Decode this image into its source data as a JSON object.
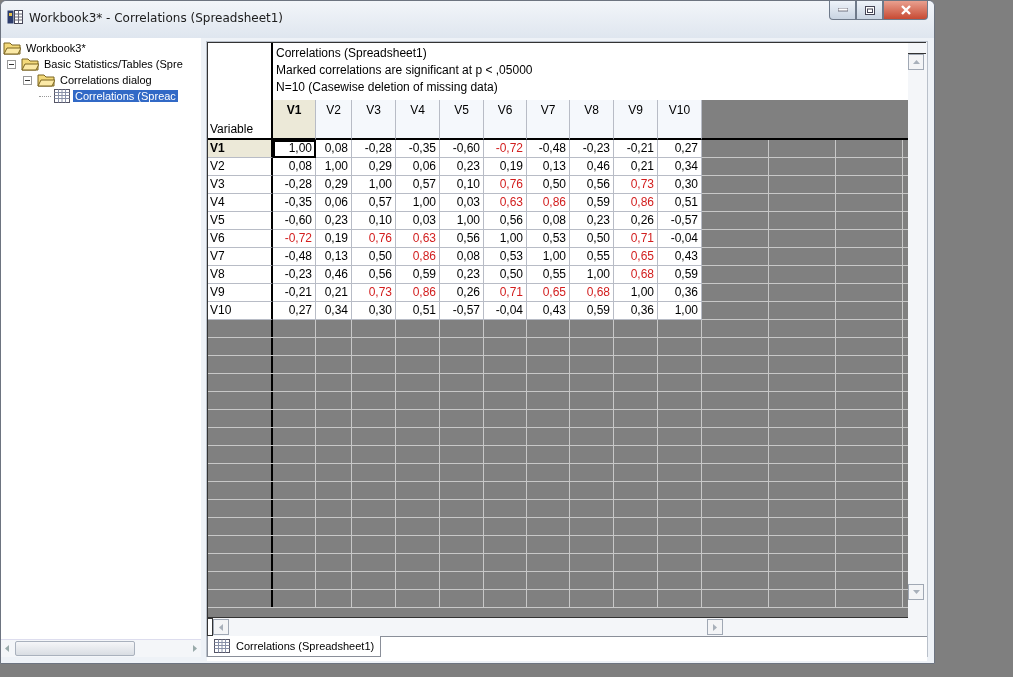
{
  "window": {
    "title": "Workbook3* - Correlations (Spreadsheet1)"
  },
  "tree": [
    {
      "label": "Workbook3*",
      "kind": "folder",
      "selected": false,
      "children": [
        {
          "label": "Basic Statistics/Tables (Spre",
          "kind": "folder",
          "expanded": true,
          "selected": false,
          "children": [
            {
              "label": "Correlations dialog",
              "kind": "folder",
              "expanded": true,
              "selected": false,
              "children": [
                {
                  "label": "Correlations (Spreac",
                  "kind": "spreadsheet",
                  "selected": true
                }
              ]
            }
          ]
        }
      ]
    }
  ],
  "sheet": {
    "header_lines": [
      "Correlations (Spreadsheet1)",
      "Marked correlations are significant at p < ,05000",
      "N=10 (Casewise deletion of missing data)"
    ],
    "row_header_label": "Variable",
    "columns": [
      {
        "label": "V1",
        "selected": true
      },
      {
        "label": "V2",
        "selected": false
      },
      {
        "label": "V3",
        "selected": false
      },
      {
        "label": "V4",
        "selected": false
      },
      {
        "label": "V5",
        "selected": false
      },
      {
        "label": "V6",
        "selected": false
      },
      {
        "label": "V7",
        "selected": false
      },
      {
        "label": "V8",
        "selected": false
      },
      {
        "label": "V9",
        "selected": false
      },
      {
        "label": "V10",
        "selected": false
      }
    ],
    "rows": [
      {
        "label": "V1",
        "selected": true,
        "cells": [
          {
            "value": "1,00",
            "significant": false
          },
          {
            "value": "0,08",
            "significant": false
          },
          {
            "value": "-0,28",
            "significant": false
          },
          {
            "value": "-0,35",
            "significant": false
          },
          {
            "value": "-0,60",
            "significant": false
          },
          {
            "value": "-0,72",
            "significant": true
          },
          {
            "value": "-0,48",
            "significant": false
          },
          {
            "value": "-0,23",
            "significant": false
          },
          {
            "value": "-0,21",
            "significant": false
          },
          {
            "value": "0,27",
            "significant": false
          }
        ]
      },
      {
        "label": "V2",
        "selected": false,
        "cells": [
          {
            "value": "0,08",
            "significant": false
          },
          {
            "value": "1,00",
            "significant": false
          },
          {
            "value": "0,29",
            "significant": false
          },
          {
            "value": "0,06",
            "significant": false
          },
          {
            "value": "0,23",
            "significant": false
          },
          {
            "value": "0,19",
            "significant": false
          },
          {
            "value": "0,13",
            "significant": false
          },
          {
            "value": "0,46",
            "significant": false
          },
          {
            "value": "0,21",
            "significant": false
          },
          {
            "value": "0,34",
            "significant": false
          }
        ]
      },
      {
        "label": "V3",
        "selected": false,
        "cells": [
          {
            "value": "-0,28",
            "significant": false
          },
          {
            "value": "0,29",
            "significant": false
          },
          {
            "value": "1,00",
            "significant": false
          },
          {
            "value": "0,57",
            "significant": false
          },
          {
            "value": "0,10",
            "significant": false
          },
          {
            "value": "0,76",
            "significant": true
          },
          {
            "value": "0,50",
            "significant": false
          },
          {
            "value": "0,56",
            "significant": false
          },
          {
            "value": "0,73",
            "significant": true
          },
          {
            "value": "0,30",
            "significant": false
          }
        ]
      },
      {
        "label": "V4",
        "selected": false,
        "cells": [
          {
            "value": "-0,35",
            "significant": false
          },
          {
            "value": "0,06",
            "significant": false
          },
          {
            "value": "0,57",
            "significant": false
          },
          {
            "value": "1,00",
            "significant": false
          },
          {
            "value": "0,03",
            "significant": false
          },
          {
            "value": "0,63",
            "significant": true
          },
          {
            "value": "0,86",
            "significant": true
          },
          {
            "value": "0,59",
            "significant": false
          },
          {
            "value": "0,86",
            "significant": true
          },
          {
            "value": "0,51",
            "significant": false
          }
        ]
      },
      {
        "label": "V5",
        "selected": false,
        "cells": [
          {
            "value": "-0,60",
            "significant": false
          },
          {
            "value": "0,23",
            "significant": false
          },
          {
            "value": "0,10",
            "significant": false
          },
          {
            "value": "0,03",
            "significant": false
          },
          {
            "value": "1,00",
            "significant": false
          },
          {
            "value": "0,56",
            "significant": false
          },
          {
            "value": "0,08",
            "significant": false
          },
          {
            "value": "0,23",
            "significant": false
          },
          {
            "value": "0,26",
            "significant": false
          },
          {
            "value": "-0,57",
            "significant": false
          }
        ]
      },
      {
        "label": "V6",
        "selected": false,
        "cells": [
          {
            "value": "-0,72",
            "significant": true
          },
          {
            "value": "0,19",
            "significant": false
          },
          {
            "value": "0,76",
            "significant": true
          },
          {
            "value": "0,63",
            "significant": true
          },
          {
            "value": "0,56",
            "significant": false
          },
          {
            "value": "1,00",
            "significant": false
          },
          {
            "value": "0,53",
            "significant": false
          },
          {
            "value": "0,50",
            "significant": false
          },
          {
            "value": "0,71",
            "significant": true
          },
          {
            "value": "-0,04",
            "significant": false
          }
        ]
      },
      {
        "label": "V7",
        "selected": false,
        "cells": [
          {
            "value": "-0,48",
            "significant": false
          },
          {
            "value": "0,13",
            "significant": false
          },
          {
            "value": "0,50",
            "significant": false
          },
          {
            "value": "0,86",
            "significant": true
          },
          {
            "value": "0,08",
            "significant": false
          },
          {
            "value": "0,53",
            "significant": false
          },
          {
            "value": "1,00",
            "significant": false
          },
          {
            "value": "0,55",
            "significant": false
          },
          {
            "value": "0,65",
            "significant": true
          },
          {
            "value": "0,43",
            "significant": false
          }
        ]
      },
      {
        "label": "V8",
        "selected": false,
        "cells": [
          {
            "value": "-0,23",
            "significant": false
          },
          {
            "value": "0,46",
            "significant": false
          },
          {
            "value": "0,56",
            "significant": false
          },
          {
            "value": "0,59",
            "significant": false
          },
          {
            "value": "0,23",
            "significant": false
          },
          {
            "value": "0,50",
            "significant": false
          },
          {
            "value": "0,55",
            "significant": false
          },
          {
            "value": "1,00",
            "significant": false
          },
          {
            "value": "0,68",
            "significant": true
          },
          {
            "value": "0,59",
            "significant": false
          }
        ]
      },
      {
        "label": "V9",
        "selected": false,
        "cells": [
          {
            "value": "-0,21",
            "significant": false
          },
          {
            "value": "0,21",
            "significant": false
          },
          {
            "value": "0,73",
            "significant": true
          },
          {
            "value": "0,86",
            "significant": true
          },
          {
            "value": "0,26",
            "significant": false
          },
          {
            "value": "0,71",
            "significant": true
          },
          {
            "value": "0,65",
            "significant": true
          },
          {
            "value": "0,68",
            "significant": true
          },
          {
            "value": "1,00",
            "significant": false
          },
          {
            "value": "0,36",
            "significant": false
          }
        ]
      },
      {
        "label": "V10",
        "selected": false,
        "cells": [
          {
            "value": "0,27",
            "significant": false
          },
          {
            "value": "0,34",
            "significant": false
          },
          {
            "value": "0,30",
            "significant": false
          },
          {
            "value": "0,51",
            "significant": false
          },
          {
            "value": "-0,57",
            "significant": false
          },
          {
            "value": "-0,04",
            "significant": false
          },
          {
            "value": "0,43",
            "significant": false
          },
          {
            "value": "0,59",
            "significant": false
          },
          {
            "value": "0,36",
            "significant": false
          },
          {
            "value": "1,00",
            "significant": false
          }
        ]
      }
    ]
  },
  "sheet_tabs": [
    {
      "label": "Correlations (Spreadsheet1)",
      "selected": true
    }
  ]
}
